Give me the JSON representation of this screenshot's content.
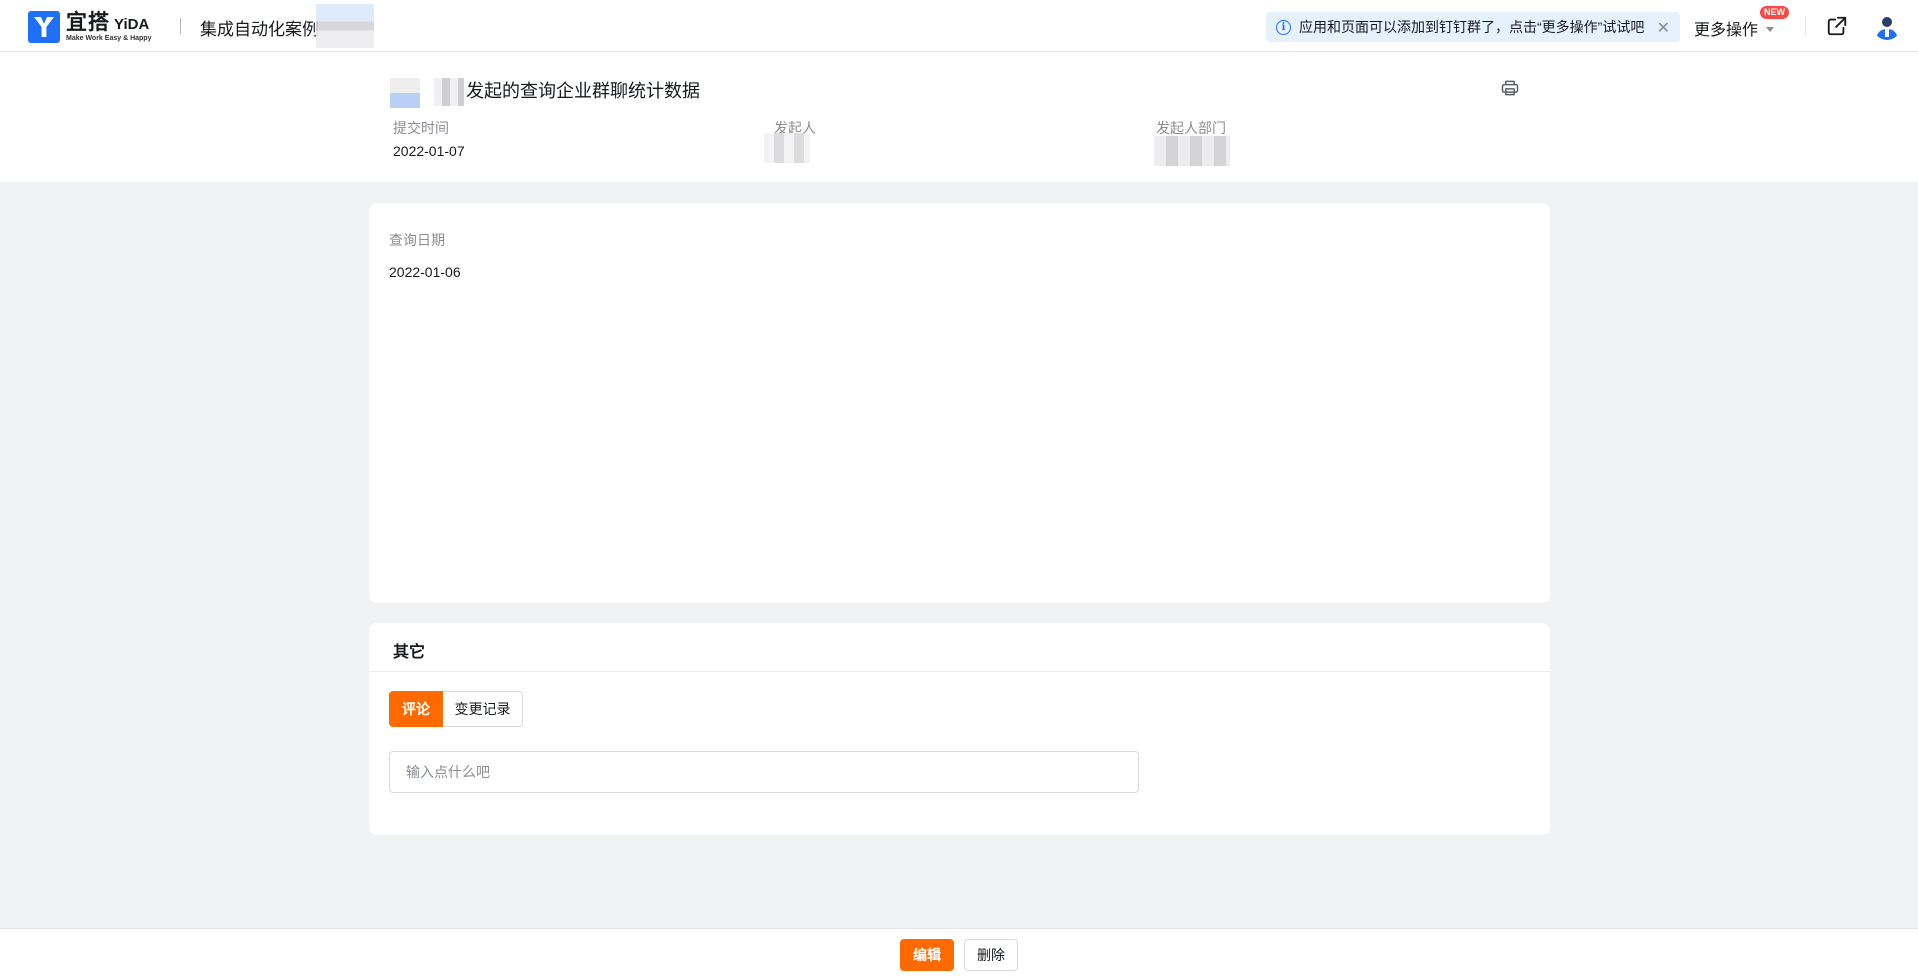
{
  "nav": {
    "logo_title": "宜搭",
    "logo_en": "YiDA",
    "logo_sub": "Make Work Easy & Happy",
    "app_name": "集成自动化案例",
    "notice_text": "应用和页面可以添加到钉钉群了，点击“更多操作”试试吧",
    "more_actions": "更多操作",
    "new_badge": "NEW"
  },
  "header": {
    "title": "发起的查询企业群聊统计数据",
    "meta": [
      {
        "label": "提交时间",
        "value": "2022-01-07"
      },
      {
        "label": "发起人",
        "value": ""
      },
      {
        "label": "发起人部门",
        "value": ""
      }
    ]
  },
  "form": {
    "fields": [
      {
        "label": "查询日期",
        "value": "2022-01-06"
      }
    ]
  },
  "other": {
    "title": "其它",
    "tabs": [
      {
        "label": "评论",
        "active": true
      },
      {
        "label": "变更记录",
        "active": false
      }
    ],
    "comment_placeholder": "输入点什么吧"
  },
  "footer": {
    "edit_label": "编辑",
    "delete_label": "删除"
  },
  "colors": {
    "accent": "#ff6a00",
    "brand": "#1f6ff7",
    "notice_bg": "#e6f1fe",
    "badge": "#f54a45"
  }
}
